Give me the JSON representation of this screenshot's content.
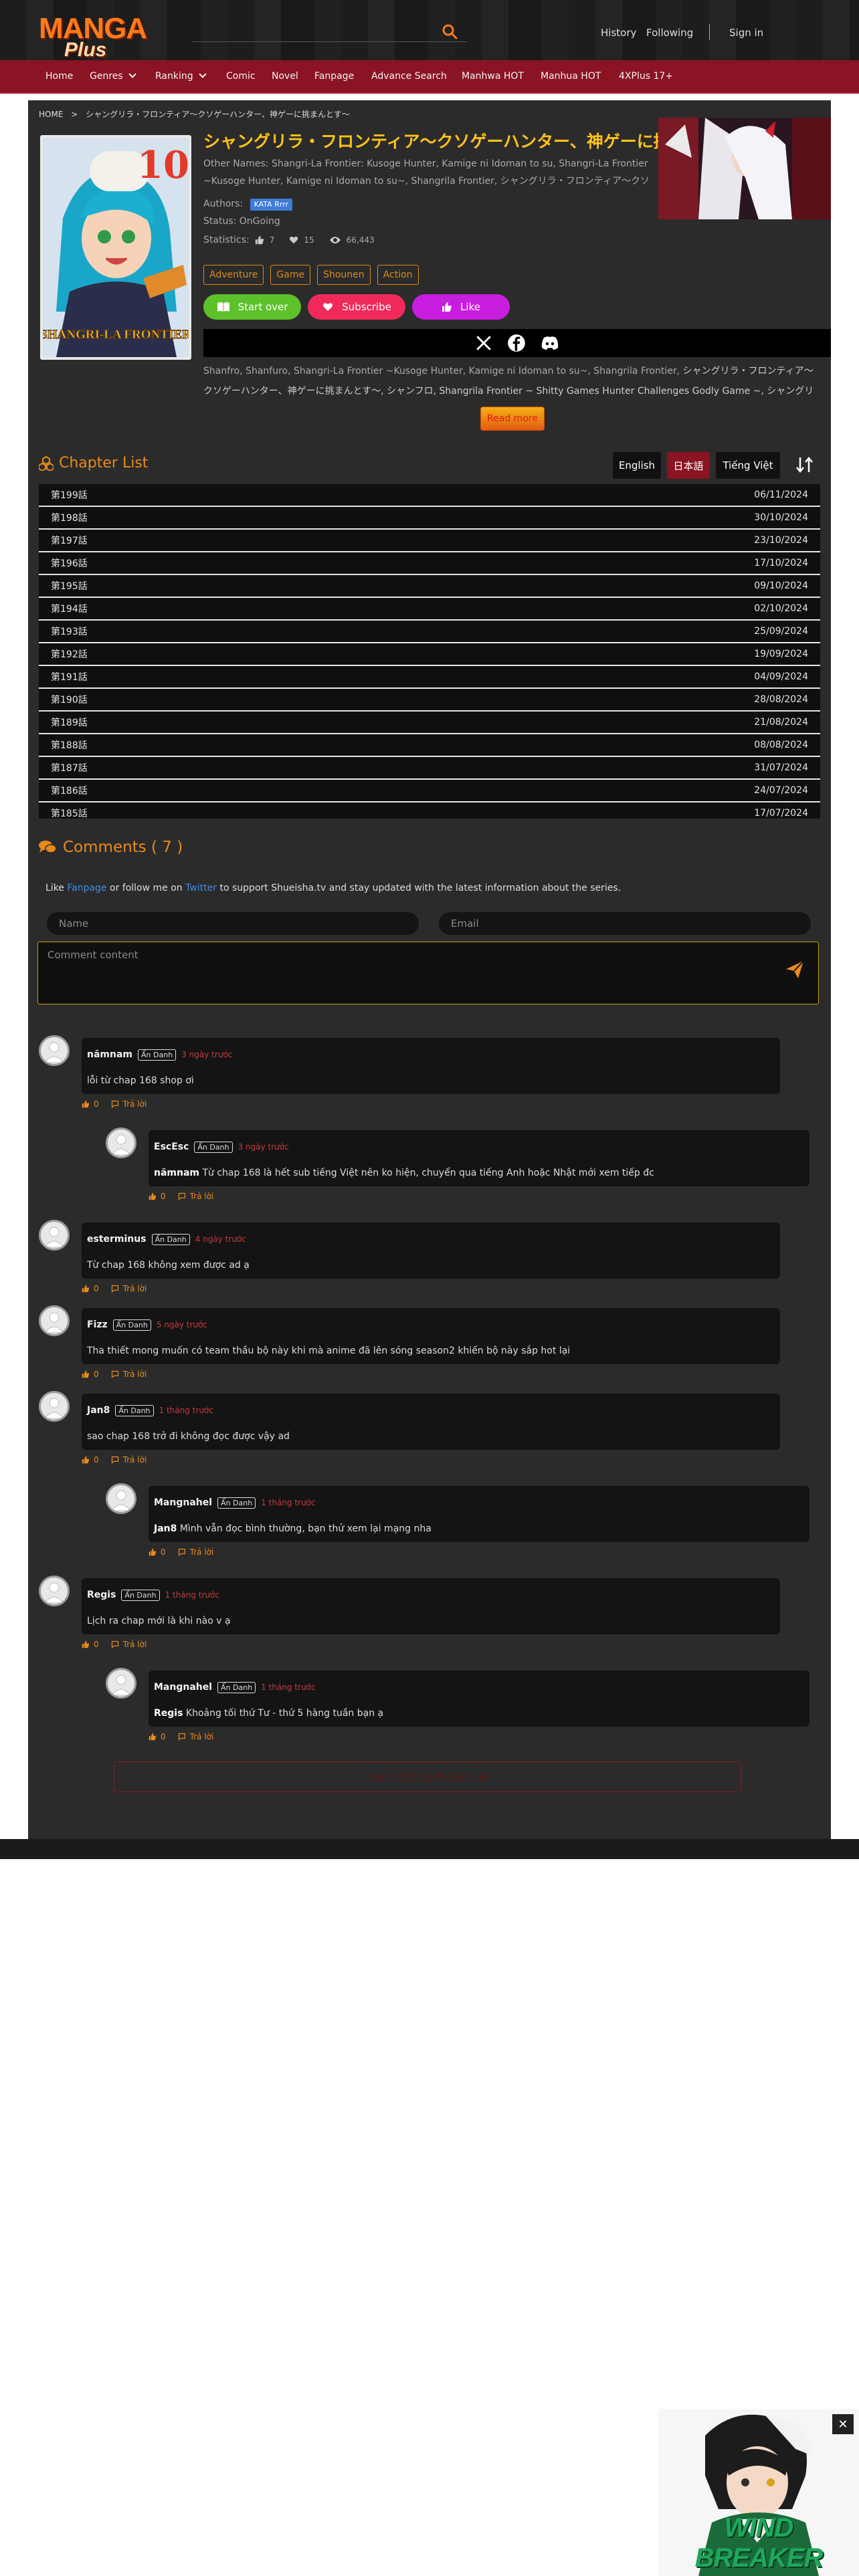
{
  "header": {
    "logo_top": "MANGA",
    "logo_bottom": "Plus",
    "search_placeholder": "",
    "links": [
      "History",
      "Following",
      "Sign in"
    ]
  },
  "nav": {
    "items": [
      "Home",
      "Genres",
      "Ranking",
      "Comic",
      "Novel",
      "Fanpage",
      "Advance Search",
      "Manhwa HOT",
      "Manhua HOT",
      "4XPlus 17+"
    ]
  },
  "breadcrumb": {
    "home": "HOME",
    "sep": ">",
    "current": "シャングリラ・フロンティア〜クソゲーハンター、神ゲーに挑まんとす〜"
  },
  "manga": {
    "title": "シャングリラ・フロンティア〜クソゲーハンター、神ゲーに挑まんとす〜",
    "other_names_label": "Other Names:",
    "other_names": "Shangri-La Frontier: Kusoge Hunter, Kamige ni Idoman to su, Shangri-La Frontier ~Kusoge Hunter, Kamige ni Idoman to su~, Shangrila Frontier, シャングリラ・フロンティア〜クソゲーハンター、神ゲーに挑まんとす〜",
    "authors_label": "Authors:",
    "author": "KATA Rrrr",
    "status_label": "Status:",
    "status": "OnGoing",
    "statistics_label": "Statistics:",
    "likes": "7",
    "hearts": "15",
    "views": "66,443",
    "tags": [
      "Adventure",
      "Game",
      "Shounen",
      "Action"
    ],
    "btn_start": "Start over",
    "btn_subscribe": "Subscribe",
    "btn_like": "Like",
    "description_prefix": "Shanfro, Shanfuro, Shangri-La Frontier ~Kusoge Hunter, Kamige ni Idoman to su~, Shangrila Frontier,",
    "description_rest": "シャングリラ・フロンティア〜クソゲーハンター、神ゲーに挑まんとす〜, シャンフロ, Shangrila Frontier ~ Shitty Games Hunter Challenges Godly Game ~, シャングリラ・フロンティア",
    "read_more": "Read more",
    "cover_number": "10",
    "cover_title": "SHANGRI-LA FRONTIER"
  },
  "chapters": {
    "heading": "Chapter List",
    "languages": [
      "English",
      "日本語",
      "Tiếng Việt"
    ],
    "active_language": "日本語",
    "items": [
      {
        "name": "第199話",
        "date": "06/11/2024"
      },
      {
        "name": "第198話",
        "date": "30/10/2024"
      },
      {
        "name": "第197話",
        "date": "23/10/2024"
      },
      {
        "name": "第196話",
        "date": "17/10/2024"
      },
      {
        "name": "第195話",
        "date": "09/10/2024"
      },
      {
        "name": "第194話",
        "date": "02/10/2024"
      },
      {
        "name": "第193話",
        "date": "25/09/2024"
      },
      {
        "name": "第192話",
        "date": "19/09/2024"
      },
      {
        "name": "第191話",
        "date": "04/09/2024"
      },
      {
        "name": "第190話",
        "date": "28/08/2024"
      },
      {
        "name": "第189話",
        "date": "21/08/2024"
      },
      {
        "name": "第188話",
        "date": "08/08/2024"
      },
      {
        "name": "第187話",
        "date": "31/07/2024"
      },
      {
        "name": "第186話",
        "date": "24/07/2024"
      },
      {
        "name": "第185話",
        "date": "17/07/2024"
      }
    ]
  },
  "comments": {
    "heading": "Comments ( 7 )",
    "intro_like": "Like",
    "intro_fanpage": "Fanpage",
    "intro_follow": "or follow me on",
    "intro_twitter": "Twitter",
    "intro_rest": "to support Shueisha.tv and stay updated with the latest information about the series.",
    "name_placeholder": "Name",
    "email_placeholder": "Email",
    "content_placeholder": "Comment content",
    "badge": "Ẩn Danh",
    "reply_label": "Trả lời",
    "items": [
      {
        "user": "nămnam",
        "time": "3 ngày trước",
        "text": "lỗi từ chap 168 shop ơi",
        "likes": "0"
      },
      {
        "user": "EscEsc",
        "time": "3 ngày trước",
        "mention": "nămnam",
        "text": "Từ chap 168 là hết sub tiếng Việt nên ko hiện, chuyển qua tiếng Anh hoặc Nhật mới xem tiếp đc",
        "likes": "0"
      },
      {
        "user": "esterminus",
        "time": "4 ngày trước",
        "text": "Từ chap 168 không xem được ad ạ",
        "likes": "0"
      },
      {
        "user": "Fizz",
        "time": "5 ngày trước",
        "text": "Tha thiết mong muốn có team thầu bộ này khi mà anime đã lên sóng season2 khiến bộ này sắp hot lại",
        "likes": "0"
      },
      {
        "user": "Jan8",
        "time": "1 tháng trước",
        "text": "sao chap 168 trở đi không đọc được vậy ad",
        "likes": "0"
      },
      {
        "user": "Mangnahel",
        "time": "1 tháng trước",
        "mention": "Jan8",
        "text": "Mình vẫn đọc bình thường, bạn thử xem lại mạng nha",
        "likes": "0"
      },
      {
        "user": "Regis",
        "time": "1 tháng trước",
        "text": "Lịch ra chap mới là khi nào v ạ",
        "likes": "0"
      },
      {
        "user": "Mangnahel",
        "time": "1 tháng trước",
        "mention": "Regis",
        "text": "Khoảng tối thứ Tư - thứ 5 hàng tuần bạn ạ",
        "likes": "0"
      }
    ],
    "view_more": "Xem thêm bình luận"
  },
  "ad": {
    "text": "WIND BREAKER",
    "close": "✕"
  }
}
